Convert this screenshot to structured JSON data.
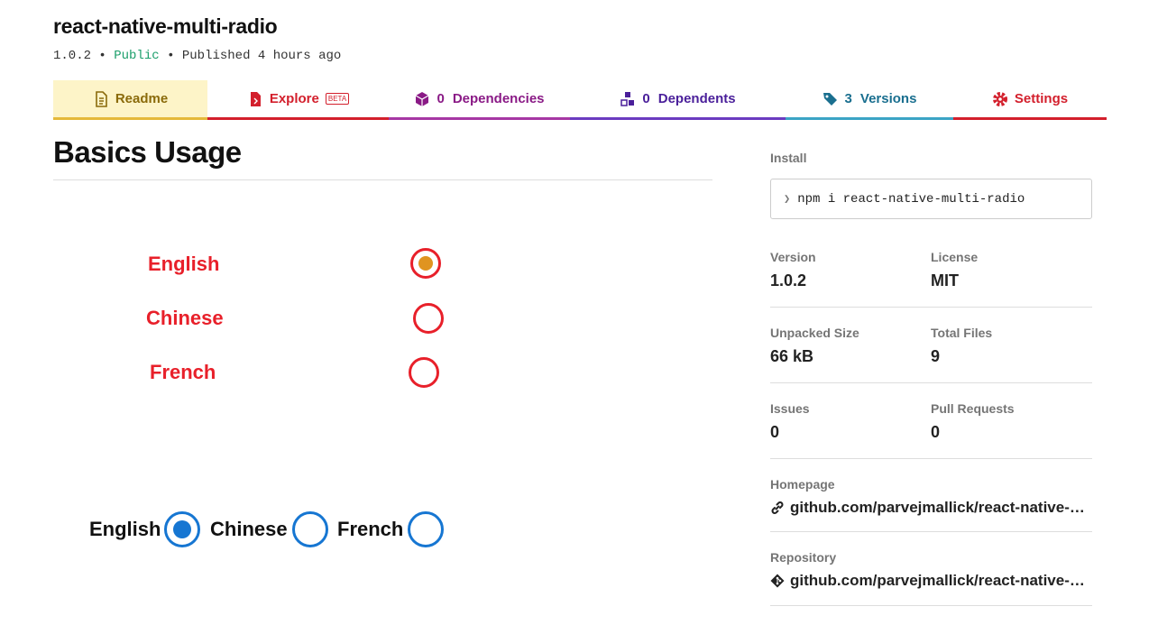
{
  "package": {
    "name": "react-native-multi-radio",
    "version": "1.0.2",
    "separator": "•",
    "visibility": "Public",
    "published": "Published 4 hours ago"
  },
  "tabs": {
    "readme": {
      "label": "Readme"
    },
    "explore": {
      "label": "Explore",
      "badge": "BETA"
    },
    "dependencies": {
      "count": "0",
      "label": "Dependencies"
    },
    "dependents": {
      "count": "0",
      "label": "Dependents"
    },
    "versions": {
      "count": "3",
      "label": "Versions"
    },
    "settings": {
      "label": "Settings"
    }
  },
  "readme": {
    "heading": "Basics Usage",
    "vertical_radios": [
      {
        "label": "English",
        "selected": true
      },
      {
        "label": "Chinese",
        "selected": false
      },
      {
        "label": "French",
        "selected": false
      }
    ],
    "horizontal_radios": [
      {
        "label": "English",
        "selected": true
      },
      {
        "label": "Chinese",
        "selected": false
      },
      {
        "label": "French",
        "selected": false
      }
    ]
  },
  "sidebar": {
    "install_label": "Install",
    "install_cmd": "npm i react-native-multi-radio",
    "version_label": "Version",
    "version_value": "1.0.2",
    "license_label": "License",
    "license_value": "MIT",
    "size_label": "Unpacked Size",
    "size_value": "66 kB",
    "files_label": "Total Files",
    "files_value": "9",
    "issues_label": "Issues",
    "issues_value": "0",
    "prs_label": "Pull Requests",
    "prs_value": "0",
    "homepage_label": "Homepage",
    "homepage_value": "github.com/parvejmallick/react-native-…",
    "repo_label": "Repository",
    "repo_value": "github.com/parvejmallick/react-native-…"
  },
  "colors": {
    "radio_red": "#e8202a",
    "radio_selected_dot": "#e09420",
    "radio_blue": "#1676d2",
    "public_green": "#1a9e6a"
  },
  "icons": [
    "readme-icon",
    "explore-icon",
    "dependencies-icon",
    "dependents-icon",
    "versions-icon",
    "settings-icon",
    "link-icon",
    "git-icon"
  ]
}
